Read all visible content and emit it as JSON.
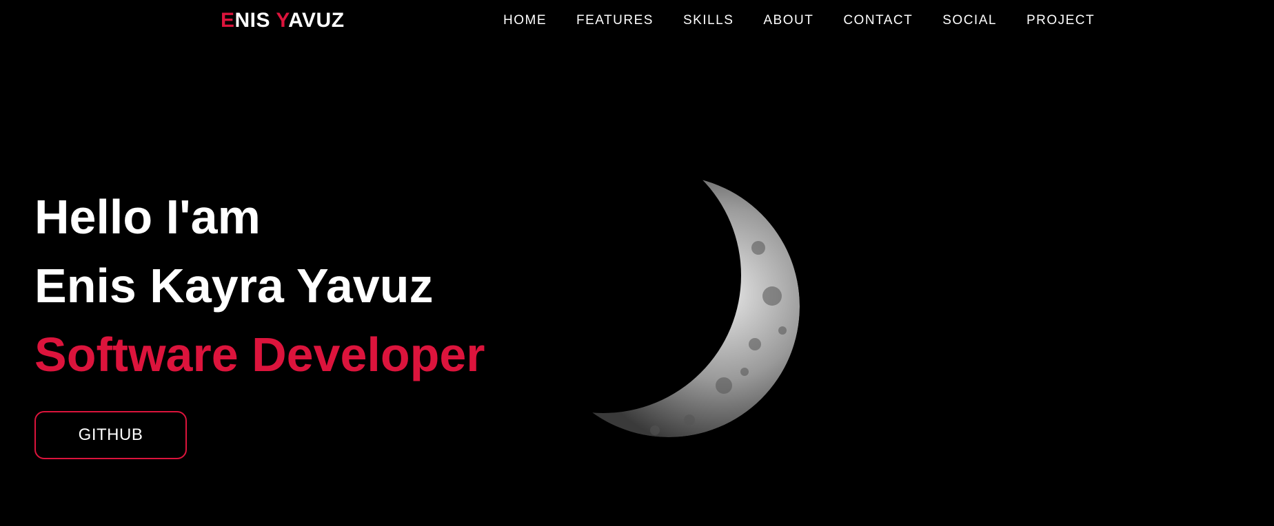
{
  "brand": {
    "first_initial": "E",
    "first_rest": "NIS ",
    "last_initial": "Y",
    "last_rest": "AVUZ"
  },
  "nav": {
    "items": [
      {
        "id": "home",
        "label": "HOME"
      },
      {
        "id": "features",
        "label": "FEATURES"
      },
      {
        "id": "skills",
        "label": "SKILLS"
      },
      {
        "id": "about",
        "label": "ABOUT"
      },
      {
        "id": "contact",
        "label": "CONTACT"
      },
      {
        "id": "social",
        "label": "SOCIAL"
      },
      {
        "id": "project",
        "label": "PROJECT"
      }
    ]
  },
  "hero": {
    "greeting": "Hello I'am",
    "name": "Enis Kayra Yavuz",
    "role": "Software Developer",
    "button_label": "GITHUB"
  },
  "colors": {
    "accent": "#dc143c",
    "background": "#000000",
    "text": "#ffffff"
  }
}
